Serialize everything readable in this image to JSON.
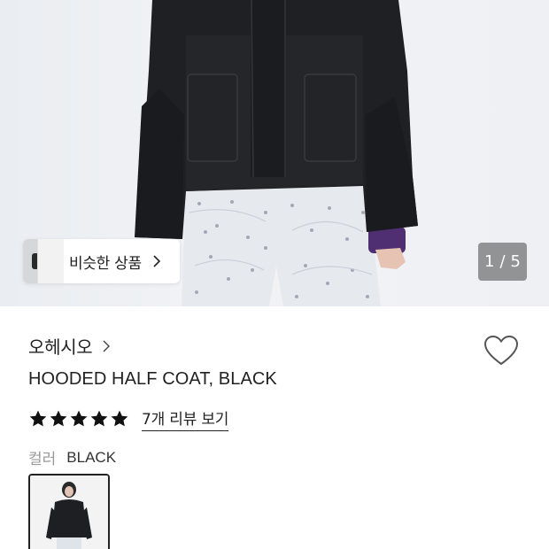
{
  "gallery": {
    "similar_label": "비슷한 상품",
    "page_current": "1",
    "page_separator": "/",
    "page_total": "5"
  },
  "product": {
    "brand": "오헤시오",
    "title": "HOODED HALF COAT, BLACK",
    "rating": 5,
    "review_link": "7개 리뷰 보기",
    "color_label": "컬러",
    "color_value": "BLACK"
  },
  "icons": {
    "chip_chevron": "chevron-right-icon",
    "brand_chevron": "chevron-right-icon",
    "wishlist": "heart-outline-icon",
    "rating": "star-filled-icon"
  },
  "colors": {
    "text": "#222222",
    "muted": "#999999",
    "indicator_bg": "#787878",
    "coat": "#1f2024",
    "sleeve_accent": "#4a2d6b"
  }
}
